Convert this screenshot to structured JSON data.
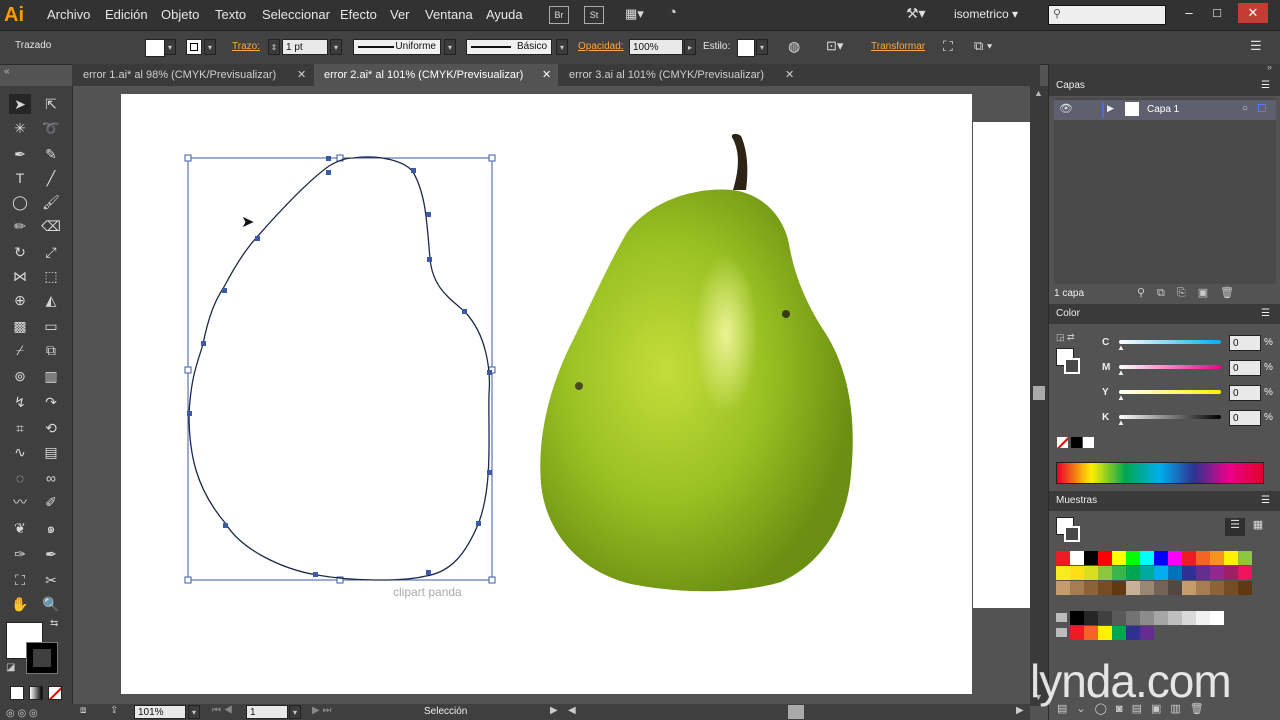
{
  "app": {
    "logo": "Ai"
  },
  "menus": [
    "Archivo",
    "Edición",
    "Objeto",
    "Texto",
    "Seleccionar",
    "Efecto",
    "Ver",
    "Ventana",
    "Ayuda"
  ],
  "bridge": {
    "br": "Br",
    "st": "St"
  },
  "workspace": "isometrico",
  "window_controls": {
    "min": "–",
    "max": "□",
    "close": "✕"
  },
  "control": {
    "object_type": "Trazado",
    "trazo_label": "Trazo:",
    "stroke_weight": "1 pt",
    "profile_uniforme": "Uniforme",
    "brush_basico": "Básico",
    "opacidad_label": "Opacidad:",
    "opacity_value": "100%",
    "estilo_label": "Estilo:",
    "transformar": "Transformar"
  },
  "tabs": [
    {
      "label": "error 1.ai* al 98% (CMYK/Previsualizar)",
      "close": "✕",
      "active": false
    },
    {
      "label": "error 2.ai* al 101% (CMYK/Previsualizar)",
      "close": "✕",
      "active": true
    },
    {
      "label": "error 3.ai al 101% (CMYK/Previsualizar)",
      "close": "✕",
      "active": false
    }
  ],
  "canvas": {
    "watermark_caption": "clipart panda",
    "brand_watermark": "lynda.com"
  },
  "layers_panel": {
    "title": "Capas",
    "layer_name": "Capa 1",
    "footer_count": "1 capa"
  },
  "color_panel": {
    "title": "Color",
    "channels": [
      {
        "label": "C",
        "value": "0",
        "pct": "%",
        "gradient": "linear-gradient(90deg,#fff,#00aeef)"
      },
      {
        "label": "M",
        "value": "0",
        "pct": "%",
        "gradient": "linear-gradient(90deg,#fff,#ec008c)"
      },
      {
        "label": "Y",
        "value": "0",
        "pct": "%",
        "gradient": "linear-gradient(90deg,#fff,#fff200)"
      },
      {
        "label": "K",
        "value": "0",
        "pct": "%",
        "gradient": "linear-gradient(90deg,#fff,#000)"
      }
    ]
  },
  "swatches_panel": {
    "title": "Muestras",
    "row1": [
      "#ed1c24",
      "#ffffff",
      "#000000",
      "#ff0000",
      "#ffff00",
      "#00ff00",
      "#00ffff",
      "#0000ff",
      "#ff00ff",
      "#ed1c24",
      "#f26522",
      "#f7941d",
      "#fff200",
      "#8dc63f"
    ],
    "row2": [
      "#f7ec1c",
      "#ffde17",
      "#d7df23",
      "#8dc63f",
      "#39b54a",
      "#00a651",
      "#00a99d",
      "#00aeef",
      "#0072bc",
      "#2e3192",
      "#662d91",
      "#92278f",
      "#9e1f63",
      "#ed145b"
    ],
    "row3": [
      "#c69c6d",
      "#a67c52",
      "#8c6239",
      "#754c24",
      "#603913",
      "#c7b299",
      "#998675",
      "#736357",
      "#534741",
      "#c69c6d",
      "#a67c52",
      "#8c6239",
      "#754c24",
      "#603913"
    ],
    "row4": [
      "#000000",
      "#262626",
      "#404040",
      "#595959",
      "#737373",
      "#8c8c8c",
      "#a6a6a6",
      "#bfbfbf",
      "#d9d9d9",
      "#f2f2f2",
      "#ffffff"
    ],
    "row5": [
      "#ed1c24",
      "#f26522",
      "#fff200",
      "#00a651",
      "#2e3192",
      "#662d91"
    ]
  },
  "status": {
    "zoom": "101%",
    "page": "1",
    "tool_name": "Selección"
  }
}
